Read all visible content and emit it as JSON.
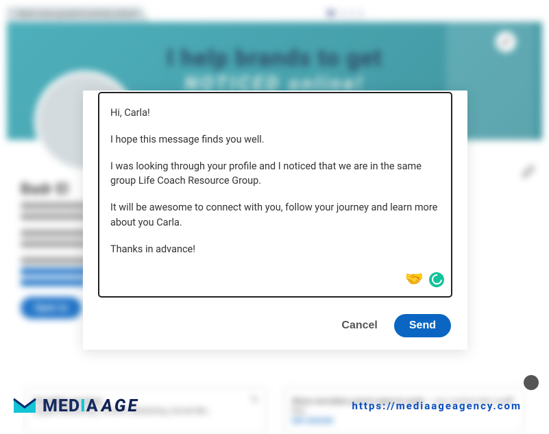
{
  "banner": {
    "top_tag": "Want more growth & activity online?",
    "top_logo": "M | | |",
    "headline": "I help brands to get",
    "subhead": "NOTICED online!"
  },
  "profile": {
    "name": "Badr El",
    "open_to": "Open to"
  },
  "dialog": {
    "message": {
      "greeting": "Hi, Carla!",
      "line1": "I hope this message finds you well.",
      "line2": "I was looking through your profile and I noticed that we are in the same group Life Coach Resource Group.",
      "line3": "It will be awesome to connect with you, follow your journey and learn more about you Carla.",
      "signoff": "Thanks in advance!"
    },
    "emoji": "🤝",
    "cancel_label": "Cancel",
    "send_label": "Send"
  },
  "cards": {
    "left_title": "Providing services",
    "left_body": "Digital Marketing, Content Marketing, Social Me...",
    "right_title": "Show recruiters you're open to work",
    "right_body": "— you control who sees this.",
    "right_cta": "Get started"
  },
  "footer": {
    "logo_media": "MED",
    "logo_age": "AGE",
    "url": "https://mediaageagency.com"
  }
}
